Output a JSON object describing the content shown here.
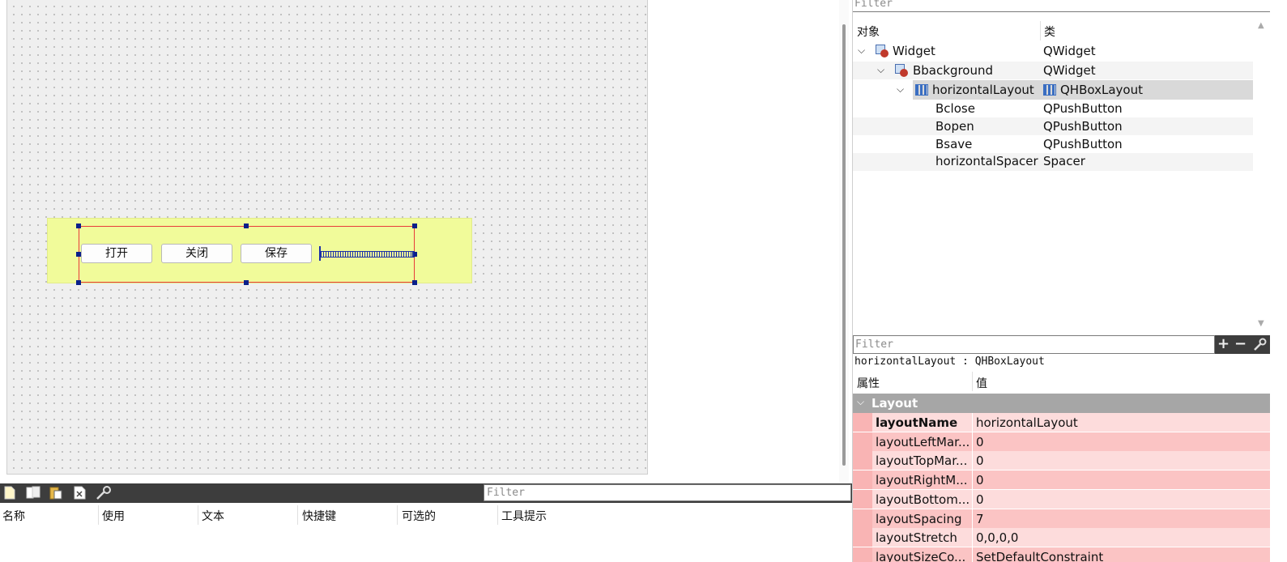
{
  "canvas": {
    "buttons": [
      "打开",
      "关闭",
      "保存"
    ]
  },
  "action_editor": {
    "filter_placeholder": "Filter",
    "columns": [
      "名称",
      "使用",
      "文本",
      "快捷键",
      "可选的",
      "工具提示"
    ]
  },
  "object_inspector": {
    "filter_placeholder": "Filter",
    "headers": [
      "对象",
      "类"
    ],
    "rows": [
      {
        "name": "Widget",
        "class": "QWidget"
      },
      {
        "name": "Bbackground",
        "class": "QWidget"
      },
      {
        "name": "horizontalLayout",
        "class": "QHBoxLayout"
      },
      {
        "name": "Bclose",
        "class": "QPushButton"
      },
      {
        "name": "Bopen",
        "class": "QPushButton"
      },
      {
        "name": "Bsave",
        "class": "QPushButton"
      },
      {
        "name": "horizontalSpacer",
        "class": "Spacer"
      }
    ]
  },
  "property_editor": {
    "filter_placeholder": "Filter",
    "object_line": "horizontalLayout : QHBoxLayout",
    "headers": [
      "属性",
      "值"
    ],
    "group": "Layout",
    "rows": [
      {
        "name": "layoutName",
        "value": "horizontalLayout"
      },
      {
        "name": "layoutLeftMar...",
        "value": "0"
      },
      {
        "name": "layoutTopMar...",
        "value": "0"
      },
      {
        "name": "layoutRightM...",
        "value": "0"
      },
      {
        "name": "layoutBottom...",
        "value": "0"
      },
      {
        "name": "layoutSpacing",
        "value": "7"
      },
      {
        "name": "layoutStretch",
        "value": "0,0,0,0"
      },
      {
        "name": "layoutSizeCo...",
        "value": "SetDefaultConstraint"
      }
    ]
  },
  "icons": {
    "object_widget": "widget-icon",
    "object_layout": "hbox-layout-icon",
    "toolbar": [
      "new-action-icon",
      "copy-icon",
      "paste-icon",
      "delete-icon",
      "configure-icon"
    ],
    "property_tools": [
      "plus-icon",
      "minus-icon",
      "wrench-icon"
    ]
  },
  "colors": {
    "background_widget": "#f1fb9a",
    "selection_border": "#e83b3b",
    "handle": "#0a1f8a",
    "property_row_light": "#fddcdc",
    "property_row_dark": "#fbc4c4",
    "group_header": "#a6a6a6"
  }
}
